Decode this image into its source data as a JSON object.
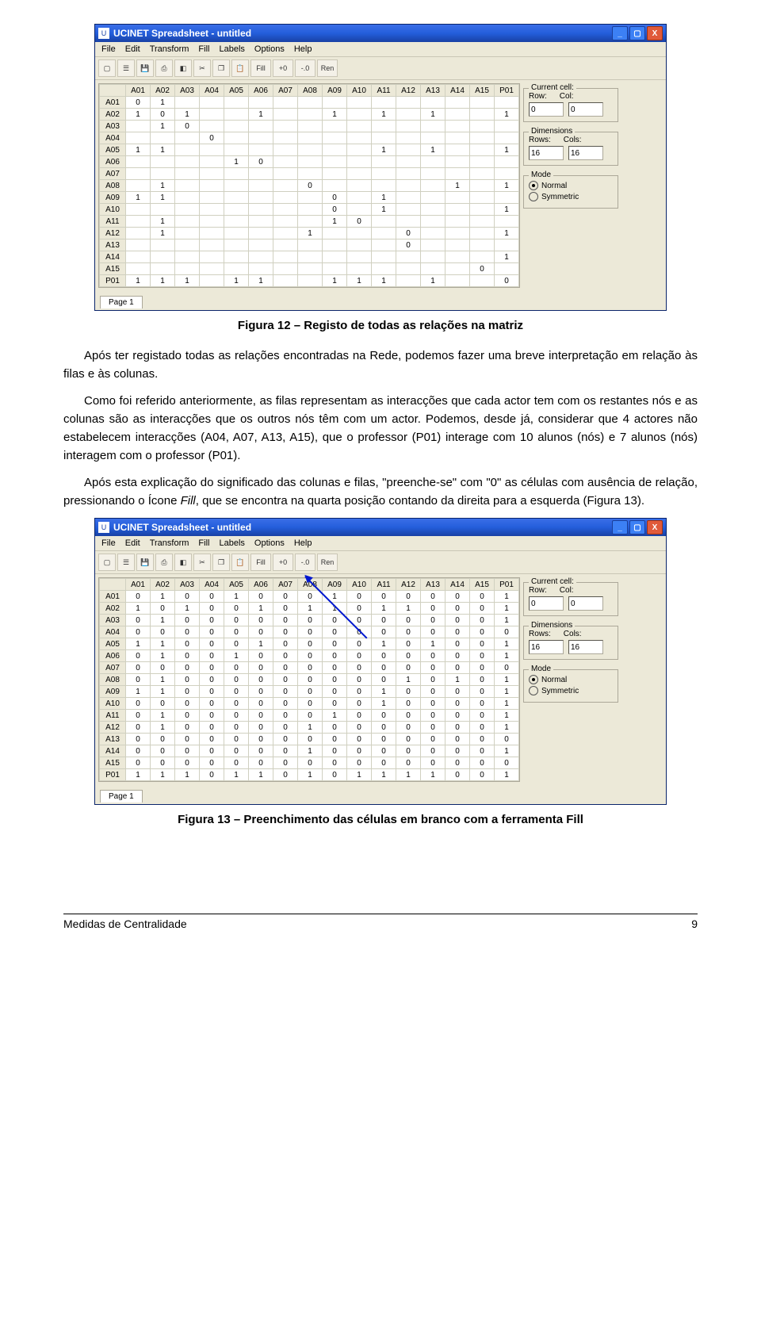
{
  "window": {
    "title": "UCINET Spreadsheet - untitled",
    "menu": [
      "File",
      "Edit",
      "Transform",
      "Fill",
      "Labels",
      "Options",
      "Help"
    ],
    "toolbar_text": [
      "Fill",
      "+0",
      "-.0",
      "Ren"
    ],
    "page_tab": "Page 1"
  },
  "side": {
    "current_cell": {
      "legend": "Current cell:",
      "row_label": "Row:",
      "col_label": "Col:",
      "row": "0",
      "col": "0"
    },
    "dimensions": {
      "legend": "Dimensions",
      "rows_label": "Rows:",
      "cols_label": "Cols:",
      "rows": "16",
      "cols": "16"
    },
    "mode": {
      "legend": "Mode",
      "opt1": "Normal",
      "opt2": "Symmetric"
    }
  },
  "table1": {
    "col_headers": [
      "A01",
      "A02",
      "A03",
      "A04",
      "A05",
      "A06",
      "A07",
      "A08",
      "A09",
      "A10",
      "A11",
      "A12",
      "A13",
      "A14",
      "A15",
      "P01"
    ],
    "rows": [
      {
        "hdr": "A01",
        "cells": [
          "0",
          "1",
          "",
          "",
          "",
          "",
          "",
          "",
          "",
          "",
          "",
          "",
          "",
          "",
          "",
          ""
        ]
      },
      {
        "hdr": "A02",
        "cells": [
          "1",
          "0",
          "1",
          "",
          "",
          "1",
          "",
          "",
          "1",
          "",
          "1",
          "",
          "1",
          "",
          "",
          "1"
        ]
      },
      {
        "hdr": "A03",
        "cells": [
          "",
          "1",
          "0",
          "",
          "",
          "",
          "",
          "",
          "",
          "",
          "",
          "",
          "",
          "",
          "",
          ""
        ]
      },
      {
        "hdr": "A04",
        "cells": [
          "",
          "",
          "",
          "0",
          "",
          "",
          "",
          "",
          "",
          "",
          "",
          "",
          "",
          "",
          "",
          ""
        ]
      },
      {
        "hdr": "A05",
        "cells": [
          "1",
          "1",
          "",
          "",
          "",
          "",
          "",
          "",
          "",
          "",
          "1",
          "",
          "1",
          "",
          "",
          "1"
        ]
      },
      {
        "hdr": "A06",
        "cells": [
          "",
          "",
          "",
          "",
          "1",
          "0",
          "",
          "",
          "",
          "",
          "",
          "",
          "",
          "",
          "",
          ""
        ]
      },
      {
        "hdr": "A07",
        "cells": [
          "",
          "",
          "",
          "",
          "",
          "",
          "",
          "",
          "",
          "",
          "",
          "",
          "",
          "",
          "",
          ""
        ]
      },
      {
        "hdr": "A08",
        "cells": [
          "",
          "1",
          "",
          "",
          "",
          "",
          "",
          "0",
          "",
          "",
          "",
          "",
          "",
          "1",
          "",
          "1"
        ]
      },
      {
        "hdr": "A09",
        "cells": [
          "1",
          "1",
          "",
          "",
          "",
          "",
          "",
          "",
          "0",
          "",
          "1",
          "",
          "",
          "",
          "",
          ""
        ]
      },
      {
        "hdr": "A10",
        "cells": [
          "",
          "",
          "",
          "",
          "",
          "",
          "",
          "",
          "0",
          "",
          "1",
          "",
          "",
          "",
          "",
          "1"
        ]
      },
      {
        "hdr": "A11",
        "cells": [
          "",
          "1",
          "",
          "",
          "",
          "",
          "",
          "",
          "1",
          "0",
          "",
          "",
          "",
          "",
          "",
          ""
        ]
      },
      {
        "hdr": "A12",
        "cells": [
          "",
          "1",
          "",
          "",
          "",
          "",
          "",
          "1",
          "",
          "",
          "",
          "0",
          "",
          "",
          "",
          "1"
        ]
      },
      {
        "hdr": "A13",
        "cells": [
          "",
          "",
          "",
          "",
          "",
          "",
          "",
          "",
          "",
          "",
          "",
          "0",
          "",
          "",
          "",
          ""
        ]
      },
      {
        "hdr": "A14",
        "cells": [
          "",
          "",
          "",
          "",
          "",
          "",
          "",
          "",
          "",
          "",
          "",
          "",
          "",
          "",
          "",
          "1"
        ]
      },
      {
        "hdr": "A15",
        "cells": [
          "",
          "",
          "",
          "",
          "",
          "",
          "",
          "",
          "",
          "",
          "",
          "",
          "",
          "",
          "0",
          ""
        ]
      },
      {
        "hdr": "P01",
        "cells": [
          "1",
          "1",
          "1",
          "",
          "1",
          "1",
          "",
          "",
          "1",
          "1",
          "1",
          "",
          "1",
          "",
          "",
          "0"
        ]
      }
    ]
  },
  "table2": {
    "col_headers": [
      "A01",
      "A02",
      "A03",
      "A04",
      "A05",
      "A06",
      "A07",
      "A08",
      "A09",
      "A10",
      "A11",
      "A12",
      "A13",
      "A14",
      "A15",
      "P01"
    ],
    "rows": [
      {
        "hdr": "A01",
        "cells": [
          "0",
          "1",
          "0",
          "0",
          "1",
          "0",
          "0",
          "0",
          "1",
          "0",
          "0",
          "0",
          "0",
          "0",
          "0",
          "1"
        ]
      },
      {
        "hdr": "A02",
        "cells": [
          "1",
          "0",
          "1",
          "0",
          "0",
          "1",
          "0",
          "1",
          "1",
          "0",
          "1",
          "1",
          "0",
          "0",
          "0",
          "1"
        ]
      },
      {
        "hdr": "A03",
        "cells": [
          "0",
          "1",
          "0",
          "0",
          "0",
          "0",
          "0",
          "0",
          "0",
          "0",
          "0",
          "0",
          "0",
          "0",
          "0",
          "1"
        ]
      },
      {
        "hdr": "A04",
        "cells": [
          "0",
          "0",
          "0",
          "0",
          "0",
          "0",
          "0",
          "0",
          "0",
          "0",
          "0",
          "0",
          "0",
          "0",
          "0",
          "0"
        ]
      },
      {
        "hdr": "A05",
        "cells": [
          "1",
          "1",
          "0",
          "0",
          "0",
          "1",
          "0",
          "0",
          "0",
          "0",
          "1",
          "0",
          "1",
          "0",
          "0",
          "1"
        ]
      },
      {
        "hdr": "A06",
        "cells": [
          "0",
          "1",
          "0",
          "0",
          "1",
          "0",
          "0",
          "0",
          "0",
          "0",
          "0",
          "0",
          "0",
          "0",
          "0",
          "1"
        ]
      },
      {
        "hdr": "A07",
        "cells": [
          "0",
          "0",
          "0",
          "0",
          "0",
          "0",
          "0",
          "0",
          "0",
          "0",
          "0",
          "0",
          "0",
          "0",
          "0",
          "0"
        ]
      },
      {
        "hdr": "A08",
        "cells": [
          "0",
          "1",
          "0",
          "0",
          "0",
          "0",
          "0",
          "0",
          "0",
          "0",
          "0",
          "1",
          "0",
          "1",
          "0",
          "1"
        ]
      },
      {
        "hdr": "A09",
        "cells": [
          "1",
          "1",
          "0",
          "0",
          "0",
          "0",
          "0",
          "0",
          "0",
          "0",
          "1",
          "0",
          "0",
          "0",
          "0",
          "1"
        ]
      },
      {
        "hdr": "A10",
        "cells": [
          "0",
          "0",
          "0",
          "0",
          "0",
          "0",
          "0",
          "0",
          "0",
          "0",
          "1",
          "0",
          "0",
          "0",
          "0",
          "1"
        ]
      },
      {
        "hdr": "A11",
        "cells": [
          "0",
          "1",
          "0",
          "0",
          "0",
          "0",
          "0",
          "0",
          "1",
          "0",
          "0",
          "0",
          "0",
          "0",
          "0",
          "1"
        ]
      },
      {
        "hdr": "A12",
        "cells": [
          "0",
          "1",
          "0",
          "0",
          "0",
          "0",
          "0",
          "1",
          "0",
          "0",
          "0",
          "0",
          "0",
          "0",
          "0",
          "1"
        ]
      },
      {
        "hdr": "A13",
        "cells": [
          "0",
          "0",
          "0",
          "0",
          "0",
          "0",
          "0",
          "0",
          "0",
          "0",
          "0",
          "0",
          "0",
          "0",
          "0",
          "0"
        ]
      },
      {
        "hdr": "A14",
        "cells": [
          "0",
          "0",
          "0",
          "0",
          "0",
          "0",
          "0",
          "1",
          "0",
          "0",
          "0",
          "0",
          "0",
          "0",
          "0",
          "1"
        ]
      },
      {
        "hdr": "A15",
        "cells": [
          "0",
          "0",
          "0",
          "0",
          "0",
          "0",
          "0",
          "0",
          "0",
          "0",
          "0",
          "0",
          "0",
          "0",
          "0",
          "0"
        ]
      },
      {
        "hdr": "P01",
        "cells": [
          "1",
          "1",
          "1",
          "0",
          "1",
          "1",
          "0",
          "1",
          "0",
          "1",
          "1",
          "1",
          "1",
          "0",
          "0",
          "1"
        ]
      }
    ]
  },
  "captions": {
    "fig12": "Figura 12 – Registo de todas as relações na matriz",
    "fig13": "Figura 13 – Preenchimento das células em branco com a ferramenta Fill"
  },
  "paragraphs": {
    "p1a": "Após ter registado todas as relações encontradas na Rede, podemos fazer uma breve interpretação em relação às filas e às colunas.",
    "p2": "Como foi referido anteriormente, as filas representam as interacções que cada actor tem com os restantes nós e as colunas são as interacções que os outros nós têm com um actor. Podemos, desde já, considerar que 4 actores não estabelecem interacções (A04, A07, A13, A15), que o professor (P01) interage com 10 alunos (nós) e 7 alunos (nós) interagem com o professor (P01).",
    "p3a": "Após esta explicação do significado das colunas e filas, \"preenche-se\" com \"0\" as células com ausência de relação, pressionando o Ícone ",
    "p3b_italic": "Fill",
    "p3c": ", que se encontra na quarta posição contando da direita para a esquerda (Figura 13)."
  },
  "footer": {
    "left": "Medidas de Centralidade",
    "right": "9"
  }
}
